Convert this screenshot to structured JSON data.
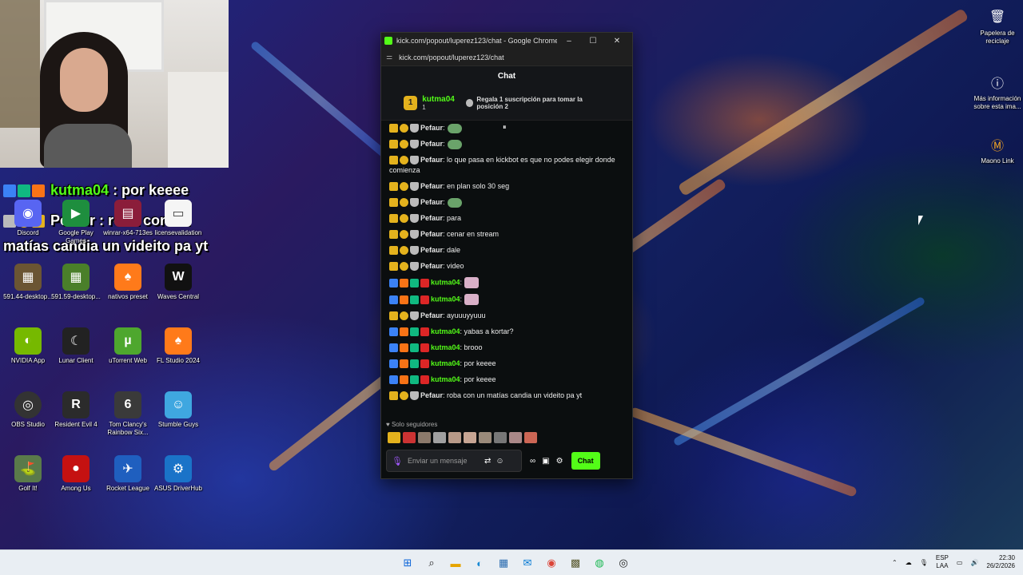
{
  "overlay_chat": [
    {
      "user": "kutma04",
      "text": " : por keeee"
    },
    {
      "user": "Pefaur",
      "text": " : roba con un"
    },
    {
      "user": "",
      "text": "matías candia un videito pa yt"
    }
  ],
  "desktop_icons_left": [
    {
      "label": "Discord",
      "icon": "discord-icon"
    },
    {
      "label": "Google Play Games",
      "icon": "google-play-icon"
    },
    {
      "label": "winrar-x64-713es",
      "icon": "winrar-icon"
    },
    {
      "label": "licensevalidation",
      "icon": "document-icon"
    },
    {
      "label": "591.44-desktop...",
      "icon": "nvidia-driver-icon"
    },
    {
      "label": "591.59-desktop...",
      "icon": "nvidia-driver-icon"
    },
    {
      "label": "nativos preset",
      "icon": "fl-studio-icon"
    },
    {
      "label": "Waves Central",
      "icon": "waves-icon"
    },
    {
      "label": "NVIDIA App",
      "icon": "nvidia-icon"
    },
    {
      "label": "Lunar Client",
      "icon": "lunar-client-icon"
    },
    {
      "label": "uTorrent Web",
      "icon": "utorrent-icon"
    },
    {
      "label": "FL Studio 2024",
      "icon": "fl-studio-icon"
    },
    {
      "label": "OBS Studio",
      "icon": "obs-icon"
    },
    {
      "label": "Resident Evil 4",
      "icon": "resident-evil-icon"
    },
    {
      "label": "Tom Clancy's Rainbow Six...",
      "icon": "rainbow-six-icon"
    },
    {
      "label": "Stumble Guys",
      "icon": "stumble-guys-icon"
    },
    {
      "label": "Golf It!",
      "icon": "golf-it-icon"
    },
    {
      "label": "Among Us",
      "icon": "among-us-icon"
    },
    {
      "label": "Rocket League",
      "icon": "rocket-league-icon"
    },
    {
      "label": "ASUS DriverHub",
      "icon": "asus-icon"
    }
  ],
  "desktop_icons_right": [
    {
      "label": "Papelera de reciclaje",
      "icon": "recycle-bin-icon"
    },
    {
      "label": "Más información sobre esta ima...",
      "icon": "info-icon"
    },
    {
      "label": "Maono Link",
      "icon": "maono-icon"
    }
  ],
  "browser": {
    "window_title": "kick.com/popout/luperez123/chat - Google Chrome",
    "url": "kick.com/popout/luperez123/chat",
    "min": "–",
    "max": "☐",
    "close": "✕"
  },
  "chat": {
    "header": "Chat",
    "top_gifter": {
      "rank": "1",
      "name": "kutma04",
      "count": "1"
    },
    "gift_prompt": "Regala 1 suscripción para tomar la posición 2",
    "messages": [
      {
        "user": "Pefaur",
        "text": ":",
        "style": "white",
        "badges": [
          "crown",
          "gold",
          "mug"
        ],
        "emote": "emote"
      },
      {
        "user": "Pefaur",
        "text": ":",
        "style": "white",
        "badges": [
          "crown",
          "gold",
          "mug"
        ],
        "emote": "emote"
      },
      {
        "user": "Pefaur",
        "text": ": lo que pasa en kickbot es que no podes elegir donde comienza",
        "style": "white",
        "badges": [
          "crown",
          "gold",
          "mug"
        ]
      },
      {
        "user": "Pefaur",
        "text": ": en plan solo 30 seg",
        "style": "white",
        "badges": [
          "crown",
          "gold",
          "mug"
        ]
      },
      {
        "user": "Pefaur",
        "text": ":",
        "style": "white",
        "badges": [
          "crown",
          "gold",
          "mug"
        ],
        "emote": "emote"
      },
      {
        "user": "Pefaur",
        "text": ": para",
        "style": "white",
        "badges": [
          "crown",
          "gold",
          "mug"
        ]
      },
      {
        "user": "Pefaur",
        "text": ": cenar en stream",
        "style": "white",
        "badges": [
          "crown",
          "gold",
          "mug"
        ]
      },
      {
        "user": "Pefaur",
        "text": ": dale",
        "style": "white",
        "badges": [
          "crown",
          "gold",
          "mug"
        ]
      },
      {
        "user": "Pefaur",
        "text": ": video",
        "style": "white",
        "badges": [
          "crown",
          "gold",
          "mug"
        ]
      },
      {
        "user": "kutma04",
        "text": ":",
        "style": "green",
        "badges": [
          "blue",
          "orange",
          "green",
          "red"
        ],
        "emote": "emote2"
      },
      {
        "user": "kutma04",
        "text": ":",
        "style": "green",
        "badges": [
          "blue",
          "orange",
          "green",
          "red"
        ],
        "emote": "emote2"
      },
      {
        "user": "Pefaur",
        "text": ": ayuuuyyuuu",
        "style": "white",
        "badges": [
          "crown",
          "gold",
          "mug"
        ]
      },
      {
        "user": "kutma04",
        "text": ": yabas a kortar?",
        "style": "green",
        "badges": [
          "blue",
          "orange",
          "green",
          "red"
        ]
      },
      {
        "user": "kutma04",
        "text": ": brooo",
        "style": "green",
        "badges": [
          "blue",
          "orange",
          "green",
          "red"
        ]
      },
      {
        "user": "kutma04",
        "text": ": por keeee",
        "style": "green",
        "badges": [
          "blue",
          "orange",
          "green",
          "red"
        ]
      },
      {
        "user": "kutma04",
        "text": ": por keeee",
        "style": "green",
        "badges": [
          "blue",
          "orange",
          "green",
          "red"
        ]
      },
      {
        "user": "Pefaur",
        "text": ": roba con un matías candia un videito pa yt",
        "style": "white",
        "badges": [
          "crown",
          "gold",
          "mug"
        ]
      }
    ],
    "followers_only": "♥ Solo seguidores",
    "input_placeholder": "Enviar un mensaje",
    "send_label": "Chat"
  },
  "tray": {
    "lang_1": "ESP",
    "lang_2": "LAA",
    "time": "22:30",
    "date": "26/2/2026"
  },
  "colors": {
    "kick_green": "#53fc18",
    "chat_bg": "#0b0e0f",
    "gold": "#e4b21d"
  }
}
